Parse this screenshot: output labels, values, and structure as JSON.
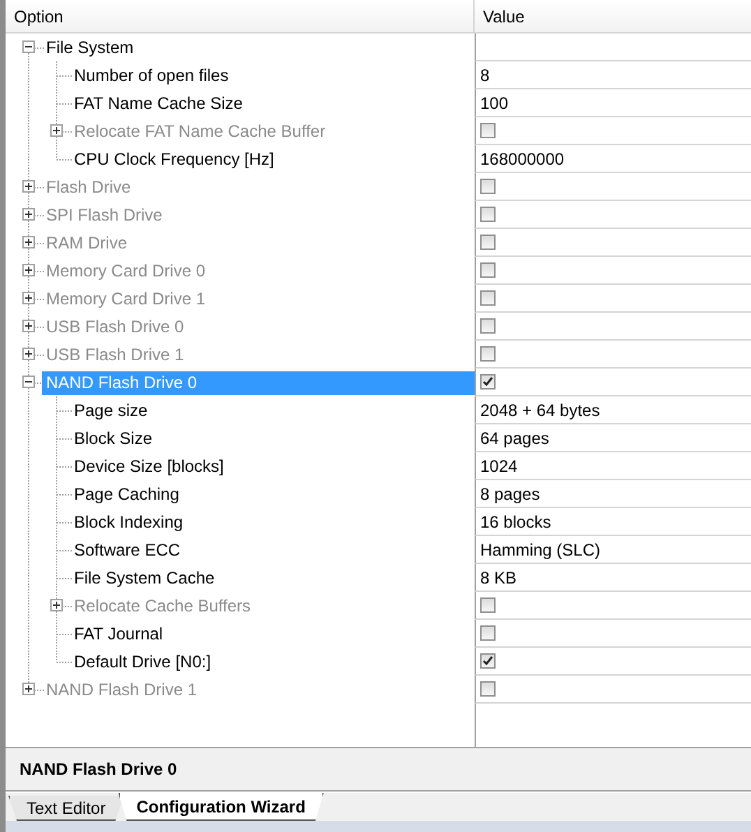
{
  "columns": [
    "Option",
    "Value"
  ],
  "tree": {
    "items": [
      {
        "label": "File System",
        "expanded": true,
        "enabled": true,
        "selected": false,
        "children": [
          {
            "label": "Number of open files",
            "enabled": true,
            "selected": false,
            "value": {
              "kind": "text",
              "text": "8"
            }
          },
          {
            "label": "FAT Name Cache Size",
            "enabled": true,
            "selected": false,
            "value": {
              "kind": "text",
              "text": "100"
            }
          },
          {
            "label": "Relocate FAT Name Cache Buffer",
            "expanded": false,
            "enabled": false,
            "selected": false,
            "value": {
              "kind": "checkbox",
              "checked": false
            }
          },
          {
            "label": "CPU Clock Frequency [Hz]",
            "enabled": true,
            "selected": false,
            "value": {
              "kind": "text",
              "text": "168000000"
            }
          }
        ]
      },
      {
        "label": "Flash Drive",
        "expanded": false,
        "enabled": false,
        "selected": false,
        "value": {
          "kind": "checkbox",
          "checked": false
        }
      },
      {
        "label": "SPI Flash Drive",
        "expanded": false,
        "enabled": false,
        "selected": false,
        "value": {
          "kind": "checkbox",
          "checked": false
        }
      },
      {
        "label": "RAM Drive",
        "expanded": false,
        "enabled": false,
        "selected": false,
        "value": {
          "kind": "checkbox",
          "checked": false
        }
      },
      {
        "label": "Memory Card Drive 0",
        "expanded": false,
        "enabled": false,
        "selected": false,
        "value": {
          "kind": "checkbox",
          "checked": false
        }
      },
      {
        "label": "Memory Card Drive 1",
        "expanded": false,
        "enabled": false,
        "selected": false,
        "value": {
          "kind": "checkbox",
          "checked": false
        }
      },
      {
        "label": "USB Flash Drive 0",
        "expanded": false,
        "enabled": false,
        "selected": false,
        "value": {
          "kind": "checkbox",
          "checked": false
        }
      },
      {
        "label": "USB Flash Drive 1",
        "expanded": false,
        "enabled": false,
        "selected": false,
        "value": {
          "kind": "checkbox",
          "checked": false
        }
      },
      {
        "label": "NAND Flash Drive 0",
        "expanded": true,
        "enabled": true,
        "selected": true,
        "value": {
          "kind": "checkbox",
          "checked": true
        },
        "children": [
          {
            "label": "Page size",
            "enabled": true,
            "selected": false,
            "value": {
              "kind": "text",
              "text": "2048 + 64 bytes"
            }
          },
          {
            "label": "Block Size",
            "enabled": true,
            "selected": false,
            "value": {
              "kind": "text",
              "text": "64 pages"
            }
          },
          {
            "label": "Device Size [blocks]",
            "enabled": true,
            "selected": false,
            "value": {
              "kind": "text",
              "text": "1024"
            }
          },
          {
            "label": "Page Caching",
            "enabled": true,
            "selected": false,
            "value": {
              "kind": "text",
              "text": "8 pages"
            }
          },
          {
            "label": "Block Indexing",
            "enabled": true,
            "selected": false,
            "value": {
              "kind": "text",
              "text": "16 blocks"
            }
          },
          {
            "label": "Software ECC",
            "enabled": true,
            "selected": false,
            "value": {
              "kind": "text",
              "text": "Hamming (SLC)"
            }
          },
          {
            "label": "File System Cache",
            "enabled": true,
            "selected": false,
            "value": {
              "kind": "text",
              "text": "8 KB"
            }
          },
          {
            "label": "Relocate Cache Buffers",
            "expanded": false,
            "enabled": false,
            "selected": false,
            "value": {
              "kind": "checkbox",
              "checked": false
            }
          },
          {
            "label": "FAT Journal",
            "enabled": true,
            "selected": false,
            "value": {
              "kind": "checkbox",
              "checked": false
            }
          },
          {
            "label": "Default Drive [N0:]",
            "enabled": true,
            "selected": false,
            "value": {
              "kind": "checkbox",
              "checked": true
            }
          }
        ]
      },
      {
        "label": "NAND Flash Drive 1",
        "expanded": false,
        "enabled": false,
        "selected": false,
        "value": {
          "kind": "checkbox",
          "checked": false
        }
      }
    ]
  },
  "status_bar": {
    "text": "NAND Flash Drive 0"
  },
  "tabs": [
    {
      "label": "Text Editor",
      "selected": false
    },
    {
      "label": "Configuration Wizard",
      "selected": true
    }
  ]
}
